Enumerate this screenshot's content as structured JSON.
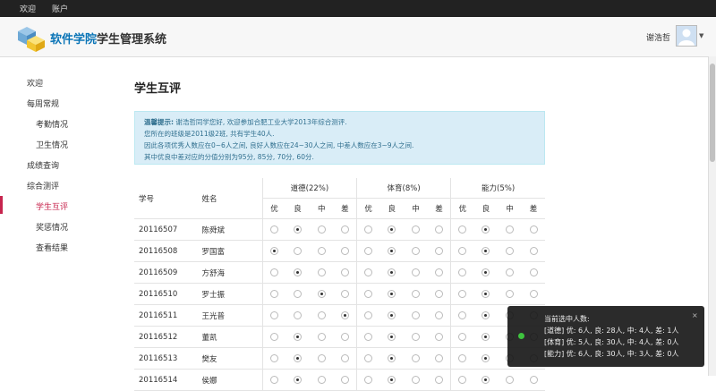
{
  "nav": {
    "welcome": "欢迎",
    "account": "账户"
  },
  "header": {
    "brand_highlight": "软件学院",
    "brand_rest": "学生管理系统",
    "username": "谢浩哲"
  },
  "sidebar": {
    "items": [
      {
        "label": "欢迎",
        "sub": false,
        "active": false
      },
      {
        "label": "每周常规",
        "sub": false,
        "active": false
      },
      {
        "label": "考勤情况",
        "sub": true,
        "active": false
      },
      {
        "label": "卫生情况",
        "sub": true,
        "active": false
      },
      {
        "label": "成绩查询",
        "sub": false,
        "active": false
      },
      {
        "label": "综合测评",
        "sub": false,
        "active": false
      },
      {
        "label": "学生互评",
        "sub": true,
        "active": true
      },
      {
        "label": "奖惩情况",
        "sub": true,
        "active": false
      },
      {
        "label": "查看结果",
        "sub": true,
        "active": false
      }
    ]
  },
  "page_title": "学生互评",
  "alert": {
    "label": "温馨提示:",
    "line1": "谢浩哲同学您好, 欢迎参加合肥工业大学2013年综合测评.",
    "line2": "您所在的班级是2011级2班, 共有学生40人.",
    "line3": "因此各项优秀人数应在0~6人之间, 良好人数应在24~30人之间, 中差人数应在3~9人之间.",
    "line4": "其中优良中差对应的分值分别为95分, 85分, 70分, 60分."
  },
  "table": {
    "col_id": "学号",
    "col_name": "姓名",
    "groups": [
      "道德(22%)",
      "体育(8%)",
      "能力(5%)"
    ],
    "grades": [
      "优",
      "良",
      "中",
      "差"
    ],
    "rows": [
      {
        "id": "20116507",
        "name": "陈舜斌",
        "sel": [
          1,
          1,
          1
        ]
      },
      {
        "id": "20116508",
        "name": "罗国富",
        "sel": [
          0,
          1,
          1
        ]
      },
      {
        "id": "20116509",
        "name": "方舒海",
        "sel": [
          1,
          1,
          1
        ]
      },
      {
        "id": "20116510",
        "name": "罗士振",
        "sel": [
          2,
          1,
          1
        ]
      },
      {
        "id": "20116511",
        "name": "王光普",
        "sel": [
          3,
          1,
          1
        ]
      },
      {
        "id": "20116512",
        "name": "董凯",
        "sel": [
          1,
          1,
          1
        ]
      },
      {
        "id": "20116513",
        "name": "樊友",
        "sel": [
          1,
          1,
          1
        ]
      },
      {
        "id": "20116514",
        "name": "侯娜",
        "sel": [
          1,
          1,
          1
        ]
      }
    ]
  },
  "notification": {
    "title": "当前选中人数:",
    "line1": "[道德] 优: 6人, 良: 28人, 中: 4人, 差: 1人",
    "line2": "[体育] 优: 5人, 良: 30人, 中: 4人, 差: 0人",
    "line3": "[能力] 优: 6人, 良: 30人, 中: 3人, 差: 0人",
    "close": "×"
  }
}
